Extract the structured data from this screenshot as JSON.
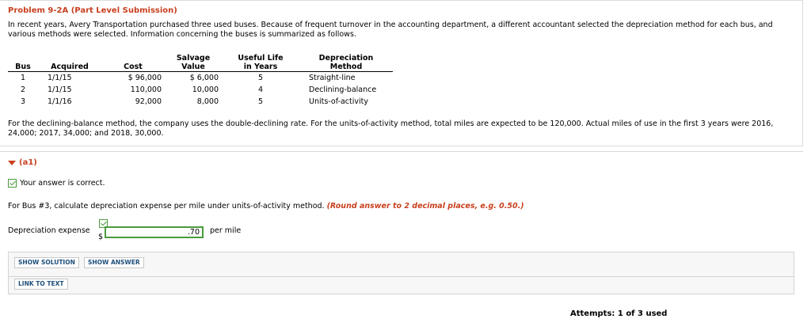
{
  "problem": {
    "title": "Problem 9-2A (Part Level Submission)",
    "intro": "In recent years, Avery Transportation purchased three used buses. Because of frequent turnover in the accounting department, a different accountant selected the depreciation method for each bus, and various methods were selected. Information concerning the buses is summarized as follows.",
    "table": {
      "headers": {
        "bus": "Bus",
        "acquired": "Acquired",
        "cost": "Cost",
        "salvage_1": "Salvage",
        "salvage_2": "Value",
        "life_1": "Useful Life",
        "life_2": "in Years",
        "method_1": "Depreciation",
        "method_2": "Method"
      },
      "rows": [
        {
          "bus": "1",
          "acquired": "1/1/15",
          "cost": "$ 96,000",
          "salvage": "$ 6,000",
          "life": "5",
          "method": "Straight-line"
        },
        {
          "bus": "2",
          "acquired": "1/1/15",
          "cost": "110,000",
          "salvage": "10,000",
          "life": "4",
          "method": "Declining-balance"
        },
        {
          "bus": "3",
          "acquired": "1/1/16",
          "cost": "92,000",
          "salvage": "8,000",
          "life": "5",
          "method": "Units-of-activity"
        }
      ]
    },
    "footer": "For the declining-balance method, the company uses the double-declining rate. For the units-of-activity method, total miles are expected to be 120,000. Actual miles of use in the first 3 years were 2016, 24,000; 2017, 34,000; and 2018, 30,000."
  },
  "part": {
    "label": "(a1)",
    "status": "Your answer is correct.",
    "question": "For Bus #3, calculate depreciation expense per mile under units-of-activity method.",
    "hint": "(Round answer to 2 decimal places, e.g. 0.50.)",
    "answer_label": "Depreciation expense",
    "currency": "$",
    "answer_value": ".70",
    "unit": "per mile"
  },
  "buttons": {
    "show_solution": "SHOW SOLUTION",
    "show_answer": "SHOW ANSWER",
    "link_to_text": "LINK TO TEXT"
  },
  "attempts": "Attempts: 1 of 3 used",
  "colors": {
    "accent": "#c8401e",
    "correct": "#4a9b3b",
    "button_text": "#1e4f7a"
  }
}
